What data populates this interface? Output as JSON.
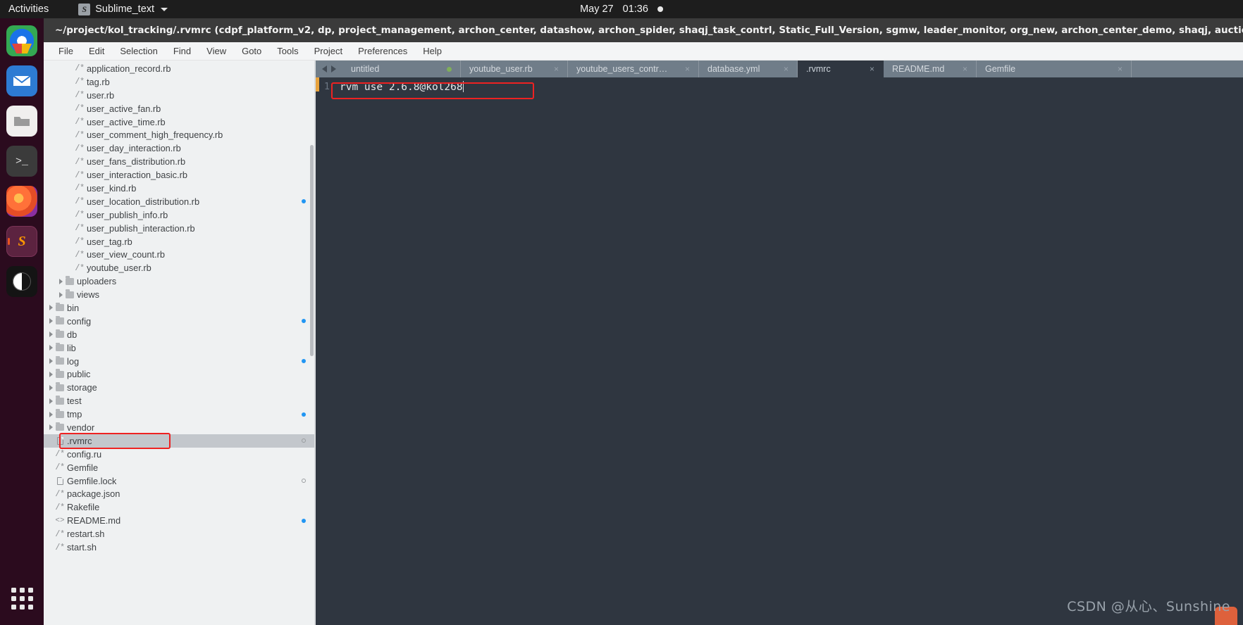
{
  "topbar": {
    "activities": "Activities",
    "app_icon": "sublime-icon",
    "app_name": "Sublime_text",
    "date": "May 27",
    "time": "01:36",
    "indicator": "recording-dot"
  },
  "dock": {
    "items": [
      {
        "name": "google-chrome",
        "label": "Google Chrome"
      },
      {
        "name": "thunderbird",
        "label": "Thunderbird Mail"
      },
      {
        "name": "files",
        "label": "Files"
      },
      {
        "name": "terminal",
        "label": "Terminal",
        "glyph": ">_"
      },
      {
        "name": "firefox",
        "label": "Firefox"
      },
      {
        "name": "sublime-text",
        "label": "Sublime Text",
        "glyph": "S",
        "active": true
      },
      {
        "name": "yy-app",
        "label": "YY"
      }
    ],
    "show_apps_label": "Show Applications"
  },
  "window": {
    "title": "~/project/kol_tracking/.rvmrc (cdpf_platform_v2, dp, project_management, archon_center, datashow, archon_spider, shaqj_task_contrl, Static_Full_Version, sgmw, leader_monitor, org_new, archon_center_demo, shaqj, auctions_center, inf."
  },
  "menubar": {
    "items": [
      "File",
      "Edit",
      "Selection",
      "Find",
      "View",
      "Goto",
      "Tools",
      "Project",
      "Preferences",
      "Help"
    ]
  },
  "sidebar": {
    "rows": [
      {
        "label": "application_record.rb",
        "icon": "code-file-icon",
        "indent": 3
      },
      {
        "label": "tag.rb",
        "icon": "code-file-icon",
        "indent": 3
      },
      {
        "label": "user.rb",
        "icon": "code-file-icon",
        "indent": 3
      },
      {
        "label": "user_active_fan.rb",
        "icon": "code-file-icon",
        "indent": 3
      },
      {
        "label": "user_active_time.rb",
        "icon": "code-file-icon",
        "indent": 3
      },
      {
        "label": "user_comment_high_frequency.rb",
        "icon": "code-file-icon",
        "indent": 3
      },
      {
        "label": "user_day_interaction.rb",
        "icon": "code-file-icon",
        "indent": 3
      },
      {
        "label": "user_fans_distribution.rb",
        "icon": "code-file-icon",
        "indent": 3
      },
      {
        "label": "user_interaction_basic.rb",
        "icon": "code-file-icon",
        "indent": 3
      },
      {
        "label": "user_kind.rb",
        "icon": "code-file-icon",
        "indent": 3
      },
      {
        "label": "user_location_distribution.rb",
        "icon": "code-file-icon",
        "indent": 3,
        "badge": "modified"
      },
      {
        "label": "user_publish_info.rb",
        "icon": "code-file-icon",
        "indent": 3
      },
      {
        "label": "user_publish_interaction.rb",
        "icon": "code-file-icon",
        "indent": 3
      },
      {
        "label": "user_tag.rb",
        "icon": "code-file-icon",
        "indent": 3
      },
      {
        "label": "user_view_count.rb",
        "icon": "code-file-icon",
        "indent": 3
      },
      {
        "label": "youtube_user.rb",
        "icon": "code-file-icon",
        "indent": 3
      },
      {
        "label": "uploaders",
        "icon": "folder-icon",
        "indent": 2,
        "arrow": true
      },
      {
        "label": "views",
        "icon": "folder-icon",
        "indent": 2,
        "arrow": true
      },
      {
        "label": "bin",
        "icon": "folder-icon",
        "indent": 1,
        "arrow": true
      },
      {
        "label": "config",
        "icon": "folder-icon",
        "indent": 1,
        "arrow": true,
        "badge": "modified"
      },
      {
        "label": "db",
        "icon": "folder-icon",
        "indent": 1,
        "arrow": true
      },
      {
        "label": "lib",
        "icon": "folder-icon",
        "indent": 1,
        "arrow": true
      },
      {
        "label": "log",
        "icon": "folder-icon",
        "indent": 1,
        "arrow": true,
        "badge": "modified"
      },
      {
        "label": "public",
        "icon": "folder-icon",
        "indent": 1,
        "arrow": true
      },
      {
        "label": "storage",
        "icon": "folder-icon",
        "indent": 1,
        "arrow": true
      },
      {
        "label": "test",
        "icon": "folder-icon",
        "indent": 1,
        "arrow": true
      },
      {
        "label": "tmp",
        "icon": "folder-icon",
        "indent": 1,
        "arrow": true,
        "badge": "modified"
      },
      {
        "label": "vendor",
        "icon": "folder-icon",
        "indent": 1,
        "arrow": true
      },
      {
        "label": ".rvmrc",
        "icon": "page-file-icon",
        "indent": 1,
        "selected": true,
        "highlighted": true,
        "badge": "open"
      },
      {
        "label": "config.ru",
        "icon": "code-file-icon",
        "indent": 1
      },
      {
        "label": "Gemfile",
        "icon": "code-file-icon",
        "indent": 1
      },
      {
        "label": "Gemfile.lock",
        "icon": "page-file-icon",
        "indent": 1,
        "badge": "open"
      },
      {
        "label": "package.json",
        "icon": "code-file-icon",
        "indent": 1
      },
      {
        "label": "Rakefile",
        "icon": "code-file-icon",
        "indent": 1
      },
      {
        "label": "README.md",
        "icon": "markup-file-icon",
        "indent": 1,
        "badge": "modified"
      },
      {
        "label": "restart.sh",
        "icon": "code-file-icon",
        "indent": 1
      },
      {
        "label": "start.sh",
        "icon": "code-file-icon",
        "indent": 1
      }
    ]
  },
  "tabs": [
    {
      "label": "untitled",
      "state": "modified"
    },
    {
      "label": "youtube_user.rb",
      "state": "closable"
    },
    {
      "label": "youtube_users_controller.rb",
      "state": "closable"
    },
    {
      "label": "database.yml",
      "state": "closable"
    },
    {
      "label": ".rvmrc",
      "state": "closable",
      "active": true
    },
    {
      "label": "README.md",
      "state": "closable"
    },
    {
      "label": "Gemfile",
      "state": "closable"
    }
  ],
  "editor": {
    "line_numbers": [
      "1"
    ],
    "lines": [
      "rvm use 2.6.8@kol268"
    ]
  },
  "watermark": {
    "text": "CSDN @从心、Sunshine"
  },
  "colors": {
    "accent_red": "#ee2222",
    "editor_bg": "#2f3640",
    "tabbar_bg": "#707d89",
    "sidebar_bg": "#eff1f2",
    "titlebar_bg": "#3b3b3b",
    "modified_dot": "#2196f3"
  }
}
